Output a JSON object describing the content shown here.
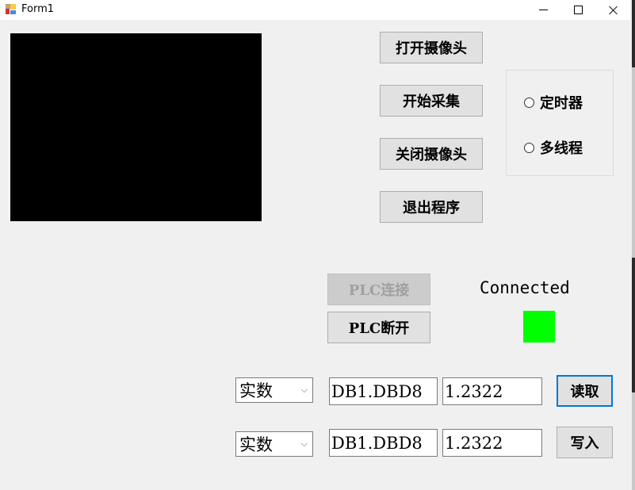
{
  "window": {
    "title": "Form1",
    "icon": "winforms-app-icon",
    "controls": {
      "minimize": "minimize-icon",
      "maximize": "maximize-icon",
      "close": "close-icon"
    }
  },
  "camera": {
    "view_color": "#000000",
    "buttons": {
      "open": "打开摄像头",
      "start_capture": "开始采集",
      "close": "关闭摄像头",
      "exit": "退出程序"
    }
  },
  "mode": {
    "options": [
      {
        "label": "定时器",
        "checked": false
      },
      {
        "label": "多线程",
        "checked": false
      }
    ]
  },
  "plc": {
    "connect_label": "PLC连接",
    "connect_enabled": false,
    "disconnect_label": "PLC断开",
    "status_text": "Connected",
    "status_color": "#00ff00"
  },
  "rows": [
    {
      "type": "实数",
      "address": "DB1.DBD8",
      "value": "1.2322",
      "action": "读取",
      "focused": true
    },
    {
      "type": "实数",
      "address": "DB1.DBD8",
      "value": "1.2322",
      "action": "写入",
      "focused": false
    }
  ],
  "colors": {
    "focus_border": "#0078d7",
    "background": "#f0f0f0"
  }
}
